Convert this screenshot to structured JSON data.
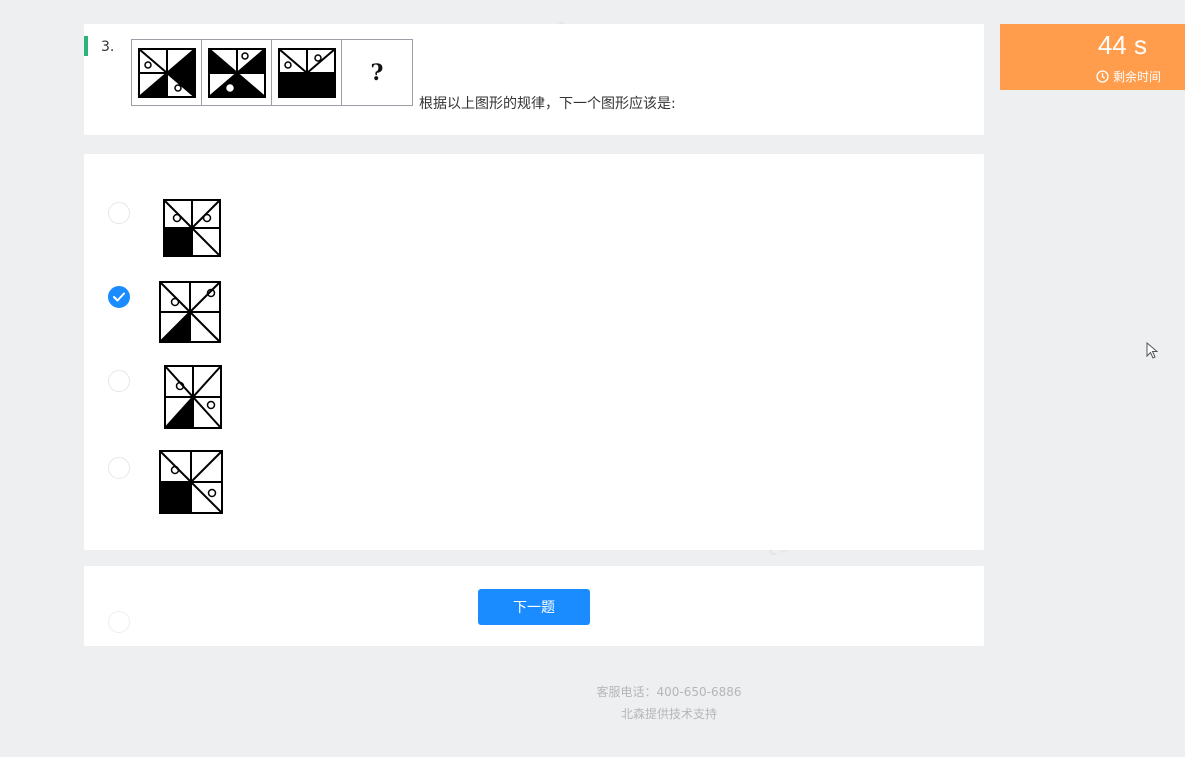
{
  "question": {
    "number": "3.",
    "prompt": "根据以上图形的规律，下一个图形应该是:",
    "placeholder_symbol": "?"
  },
  "options": [
    {
      "id": "A",
      "selected": false
    },
    {
      "id": "B",
      "selected": true
    },
    {
      "id": "C",
      "selected": false
    },
    {
      "id": "D",
      "selected": false
    }
  ],
  "next_button_label": "下一题",
  "timer": {
    "value": "44 s",
    "label": "剩余时间",
    "color": "#ff9d4d"
  },
  "footer": {
    "phone_line": "客服电话：400-650-6886",
    "support_line": "北森提供技术支持"
  },
  "colors": {
    "accent": "#1a8cff",
    "question_marker": "#2db37a",
    "background": "#eeeff0"
  }
}
